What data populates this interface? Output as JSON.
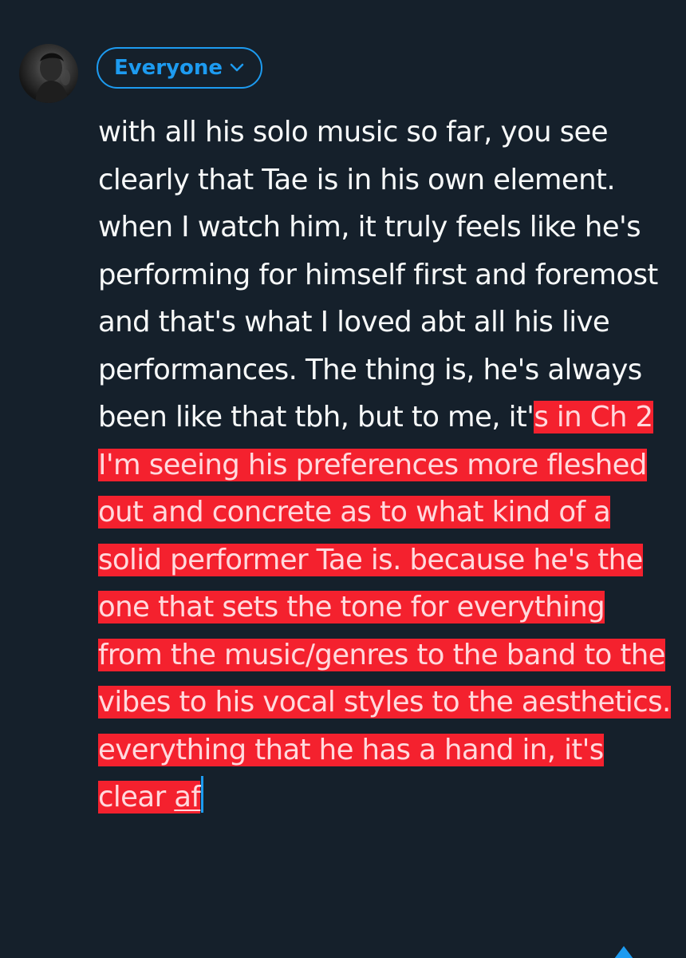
{
  "composer": {
    "audience_label": "Everyone",
    "text_plain": "with all his solo music so far, you see clearly that Tae is in his own element. when I watch him, it truly feels like he's performing for himself first and foremost and that's what I loved abt all his live performances. The thing is, he's always been like that tbh, but to me, it'",
    "text_selected": "s in Ch 2 I'm seeing his preferences more fleshed out and concrete as to what kind of a solid performer Tae is. because he's the one that sets the tone for everything from the music/genres to the band to the vibes to his vocal styles to the aesthetics. everything that he has a hand in, it's clear ",
    "text_selected_underlined": "af"
  },
  "colors": {
    "background": "#15202b",
    "accent": "#1d9bf0",
    "selection": "#f4212e",
    "text": "#f7f9f9"
  },
  "icons": {
    "audience_chevron": "chevron-down-icon",
    "avatar": "user-avatar"
  }
}
